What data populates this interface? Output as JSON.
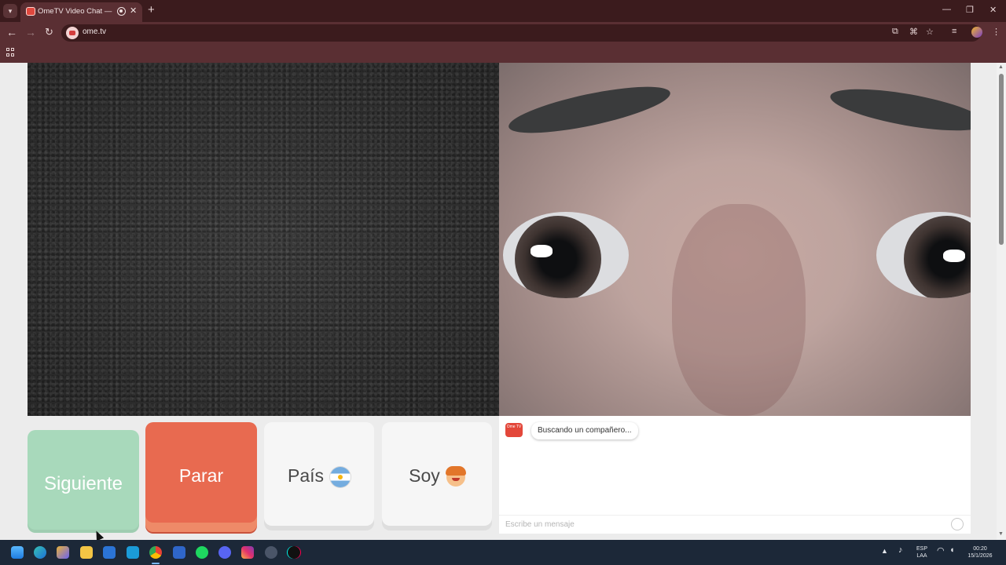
{
  "browser": {
    "tab_title": "OmeTV Video Chat — Ome",
    "url": "ome.tv",
    "new_tab": "+",
    "tab_close": "✕",
    "minimize": "—",
    "restore": "❐",
    "close": "✕"
  },
  "controls": {
    "next_label": "Siguiente",
    "stop_label": "Parar",
    "country_label": "País",
    "gender_label": "Soy",
    "colors": {
      "next": "#a8d9bb",
      "stop": "#e86a50",
      "neutral": "#f6f6f6"
    }
  },
  "chat": {
    "logo_text": "Ome TV",
    "status_message": "Buscando un compañero...",
    "input_placeholder": "Escribe un mensaje"
  },
  "taskbar": {
    "language": "ESP",
    "language_sub": "LAA",
    "time": "00:20",
    "date": "15/1/2026"
  }
}
